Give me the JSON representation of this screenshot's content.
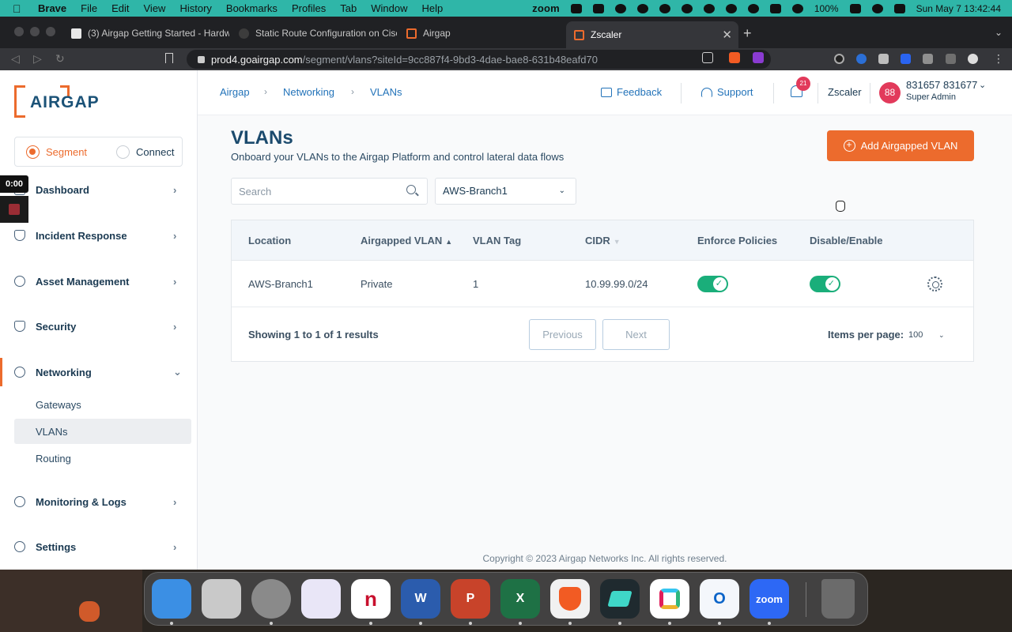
{
  "menubar": {
    "app_name": "Brave",
    "items": [
      "File",
      "Edit",
      "View",
      "History",
      "Bookmarks",
      "Profiles",
      "Tab",
      "Window",
      "Help"
    ],
    "zoom_label": "zoom",
    "battery": "100%",
    "datetime": "Sun May 7  13:42:44"
  },
  "browser": {
    "tabs": [
      {
        "title": "(3) Airgap Getting Started - Hardwa",
        "active": false
      },
      {
        "title": "Static Route Configuration on Cisco",
        "active": false
      },
      {
        "title": "Airgap",
        "active": false
      },
      {
        "title": "Zscaler",
        "active": true
      }
    ],
    "url_host": "prod4.goairgap.com",
    "url_path": "/segment/vlans?siteId=9cc887f4-9bd3-4dae-bae8-631b48eafd70"
  },
  "sidebar": {
    "logo": "AIRGAP",
    "mode_options": [
      {
        "label": "Segment",
        "selected": true
      },
      {
        "label": "Connect",
        "selected": false
      }
    ],
    "items": [
      {
        "label": "Dashboard",
        "icon": "dashboard-icon"
      },
      {
        "label": "Incident Response",
        "icon": "shield-icon"
      },
      {
        "label": "Asset Management",
        "icon": "pie-chart-icon"
      },
      {
        "label": "Security",
        "icon": "shield-check-icon"
      },
      {
        "label": "Networking",
        "icon": "network-icon"
      },
      {
        "label": "Monitoring & Logs",
        "icon": "monitor-icon"
      },
      {
        "label": "Settings",
        "icon": "gear-icon"
      }
    ],
    "networking_sub": [
      "Gateways",
      "VLANs",
      "Routing"
    ]
  },
  "recorder": {
    "time": "0:00"
  },
  "header": {
    "breadcrumb": [
      "Airgap",
      "Networking",
      "VLANs"
    ],
    "feedback": "Feedback",
    "support": "Support",
    "notification_count": "21",
    "org": "Zscaler",
    "avatar_initials": "88",
    "user_name": "831657 831677",
    "user_role": "Super Admin"
  },
  "content": {
    "title": "VLANs",
    "subtitle": "Onboard your VLANs to the Airgap Platform and control lateral data flows",
    "add_button": "Add Airgapped VLAN",
    "search_placeholder": "Search",
    "location_filter": "AWS-Branch1"
  },
  "table": {
    "columns": [
      "Location",
      "Airgapped VLAN",
      "VLAN Tag",
      "CIDR",
      "Enforce Policies",
      "Disable/Enable"
    ],
    "rows": [
      {
        "location": "AWS-Branch1",
        "vlan": "Private",
        "tag": "1",
        "cidr": "10.99.99.0/24",
        "enforce": true,
        "enabled": true
      }
    ],
    "showing": "Showing 1 to 1 of 1 results",
    "previous": "Previous",
    "next": "Next",
    "items_per_page_label": "Items per page:",
    "items_per_page": "100"
  },
  "footer": "Copyright © 2023 Airgap Networks Inc. All rights reserved.",
  "colors": {
    "accent": "#ec6b2d",
    "link": "#2373b9",
    "toggle_on": "#1aae7a",
    "menubar": "#2fb6a8"
  },
  "dock": {
    "apps": [
      {
        "name": "Finder",
        "color": "#3b8fe4"
      },
      {
        "name": "Launchpad",
        "color": "#c9c9c9"
      },
      {
        "name": "System Settings",
        "color": "#8a8a8a"
      },
      {
        "name": "Prisma Access",
        "color": "#e9e6f7"
      },
      {
        "name": "Notion",
        "color": "#ffffff"
      },
      {
        "name": "Word",
        "color": "#2b5cad"
      },
      {
        "name": "PowerPoint",
        "color": "#c8432a"
      },
      {
        "name": "Excel",
        "color": "#1e7145"
      },
      {
        "name": "Brave",
        "color": "#f1f1f1"
      },
      {
        "name": "Mirage",
        "color": "#1f2a2f"
      },
      {
        "name": "Slack",
        "color": "#ffffff"
      },
      {
        "name": "Outlook",
        "color": "#f4f7fb"
      },
      {
        "name": "Zoom",
        "color": "#2d68f5"
      },
      {
        "name": "Trash",
        "color": "#6b6b6b"
      }
    ],
    "word_glyph": "W",
    "ppt_glyph": "P",
    "excel_glyph": "X",
    "zoom_glyph": "zoom",
    "outlook_glyph": "O",
    "notion_glyph": "n"
  }
}
